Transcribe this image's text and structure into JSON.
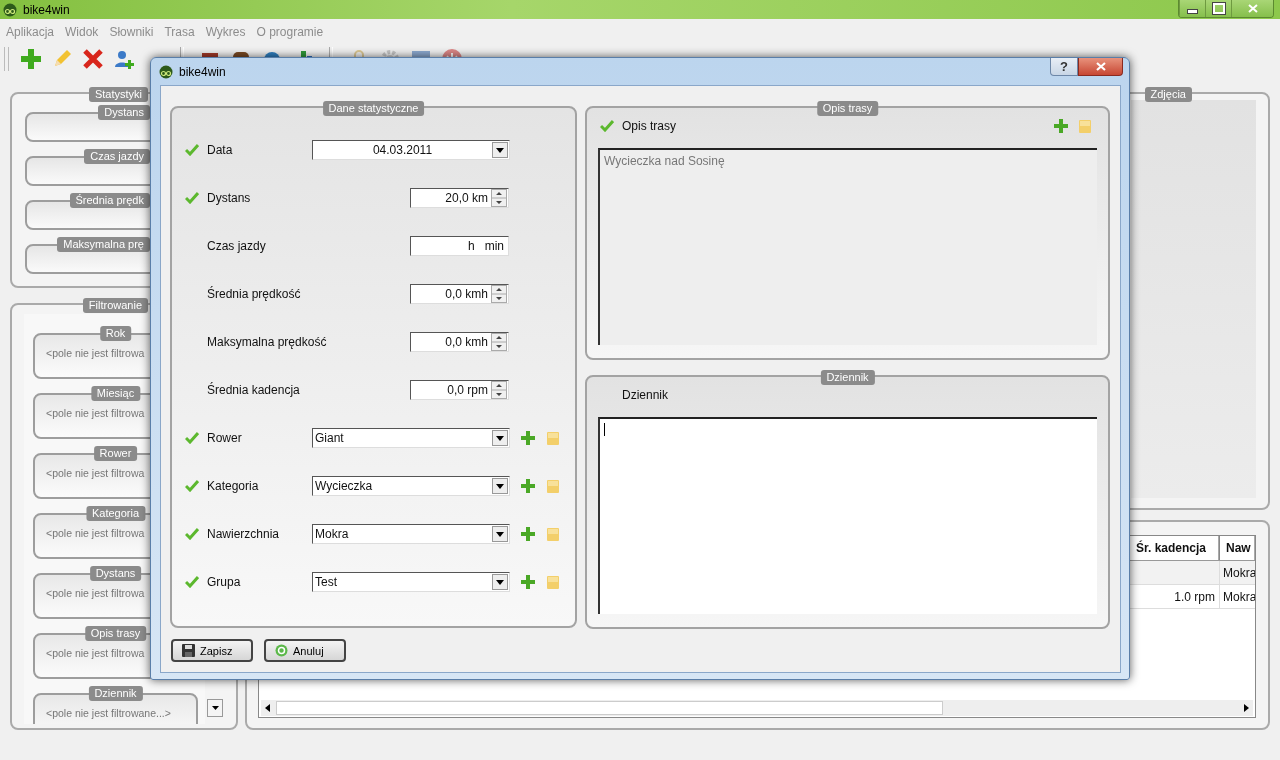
{
  "window": {
    "title": "bike4win"
  },
  "menu": [
    {
      "label": "Aplikacja",
      "disabled": true
    },
    {
      "label": "Widok",
      "disabled": true
    },
    {
      "label": "Słowniki",
      "disabled": true
    },
    {
      "label": "Trasa",
      "disabled": true
    },
    {
      "label": "Wykres",
      "disabled": true
    },
    {
      "label": "O programie",
      "disabled": true
    }
  ],
  "statistics_panel": {
    "title": "Statystyki",
    "groups": [
      {
        "label": "Dystans"
      },
      {
        "label": "Czas jazdy"
      },
      {
        "label": "Średnia prędk"
      },
      {
        "label": "Maksymalna prę"
      }
    ]
  },
  "filter_panel": {
    "title": "Filtrowanie",
    "groups": [
      {
        "label": "Rok",
        "value": "<pole nie jest filtrowa"
      },
      {
        "label": "Miesiąc",
        "value": "<pole nie jest filtrowa"
      },
      {
        "label": "Rower",
        "value": "<pole nie jest filtrowa"
      },
      {
        "label": "Kategoria",
        "value": "<pole nie jest filtrowa"
      },
      {
        "label": "Dystans",
        "value": "<pole nie jest filtrowa"
      },
      {
        "label": "Opis trasy",
        "value": "<pole nie jest filtrowa"
      },
      {
        "label": "Dziennik",
        "value": "<pole nie jest filtrowane...>"
      }
    ]
  },
  "photos_panel": {
    "title": "Zdjęcia"
  },
  "table": {
    "columns": [
      {
        "label": "Śr. kadencja"
      },
      {
        "label": "Naw"
      }
    ],
    "rows": [
      {
        "column_2": "Mokra"
      },
      {
        "cadence": "1.0 rpm",
        "column_2": "Mokra"
      }
    ]
  },
  "dialog": {
    "title": "bike4win",
    "help_button": "?",
    "stats": {
      "title": "Dane statystyczne",
      "fields": [
        {
          "kind": "date",
          "label": "Data",
          "checked": true,
          "value": "04.03.2011"
        },
        {
          "kind": "spin",
          "label": "Dystans",
          "checked": true,
          "value": "20,0 km"
        },
        {
          "kind": "time",
          "label": "Czas jazdy",
          "checked": false,
          "hours_unit": "h",
          "minutes_unit": "min"
        },
        {
          "kind": "spin",
          "label": "Średnia prędkość",
          "checked": false,
          "value": "0,0 kmh"
        },
        {
          "kind": "spin",
          "label": "Maksymalna prędkość",
          "checked": false,
          "value": "0,0 kmh"
        },
        {
          "kind": "spin",
          "label": "Średnia kadencja",
          "checked": false,
          "value": "0,0 rpm"
        },
        {
          "kind": "combo",
          "label": "Rower",
          "checked": true,
          "value": "Giant"
        },
        {
          "kind": "combo",
          "label": "Kategoria",
          "checked": true,
          "value": "Wycieczka"
        },
        {
          "kind": "combo",
          "label": "Nawierzchnia",
          "checked": true,
          "value": "Mokra"
        },
        {
          "kind": "combo",
          "label": "Grupa",
          "checked": true,
          "value": "Test"
        }
      ]
    },
    "description": {
      "title": "Opis trasy",
      "label": "Opis trasy",
      "checked": true,
      "text": "Wycieczka nad Sosinę"
    },
    "journal": {
      "title": "Dziennik",
      "label": "Dziennik",
      "checked": false
    },
    "buttons": [
      {
        "kind": "save",
        "label": "Zapisz"
      },
      {
        "kind": "cancel",
        "label": "Anuluj"
      }
    ]
  }
}
